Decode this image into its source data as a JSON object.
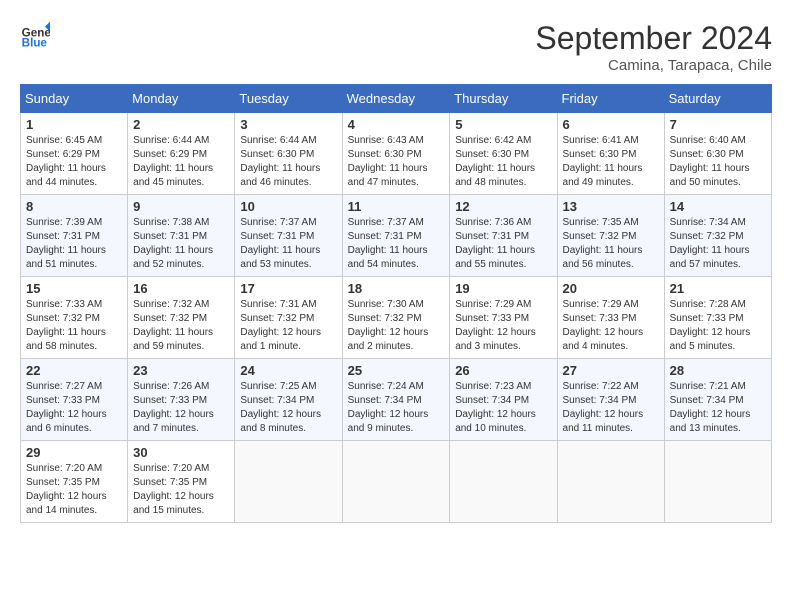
{
  "header": {
    "logo_line1": "General",
    "logo_line2": "Blue",
    "month": "September 2024",
    "location": "Camina, Tarapaca, Chile"
  },
  "weekdays": [
    "Sunday",
    "Monday",
    "Tuesday",
    "Wednesday",
    "Thursday",
    "Friday",
    "Saturday"
  ],
  "weeks": [
    [
      {
        "day": "1",
        "info": "Sunrise: 6:45 AM\nSunset: 6:29 PM\nDaylight: 11 hours\nand 44 minutes."
      },
      {
        "day": "2",
        "info": "Sunrise: 6:44 AM\nSunset: 6:29 PM\nDaylight: 11 hours\nand 45 minutes."
      },
      {
        "day": "3",
        "info": "Sunrise: 6:44 AM\nSunset: 6:30 PM\nDaylight: 11 hours\nand 46 minutes."
      },
      {
        "day": "4",
        "info": "Sunrise: 6:43 AM\nSunset: 6:30 PM\nDaylight: 11 hours\nand 47 minutes."
      },
      {
        "day": "5",
        "info": "Sunrise: 6:42 AM\nSunset: 6:30 PM\nDaylight: 11 hours\nand 48 minutes."
      },
      {
        "day": "6",
        "info": "Sunrise: 6:41 AM\nSunset: 6:30 PM\nDaylight: 11 hours\nand 49 minutes."
      },
      {
        "day": "7",
        "info": "Sunrise: 6:40 AM\nSunset: 6:30 PM\nDaylight: 11 hours\nand 50 minutes."
      }
    ],
    [
      {
        "day": "8",
        "info": "Sunrise: 7:39 AM\nSunset: 7:31 PM\nDaylight: 11 hours\nand 51 minutes."
      },
      {
        "day": "9",
        "info": "Sunrise: 7:38 AM\nSunset: 7:31 PM\nDaylight: 11 hours\nand 52 minutes."
      },
      {
        "day": "10",
        "info": "Sunrise: 7:37 AM\nSunset: 7:31 PM\nDaylight: 11 hours\nand 53 minutes."
      },
      {
        "day": "11",
        "info": "Sunrise: 7:37 AM\nSunset: 7:31 PM\nDaylight: 11 hours\nand 54 minutes."
      },
      {
        "day": "12",
        "info": "Sunrise: 7:36 AM\nSunset: 7:31 PM\nDaylight: 11 hours\nand 55 minutes."
      },
      {
        "day": "13",
        "info": "Sunrise: 7:35 AM\nSunset: 7:32 PM\nDaylight: 11 hours\nand 56 minutes."
      },
      {
        "day": "14",
        "info": "Sunrise: 7:34 AM\nSunset: 7:32 PM\nDaylight: 11 hours\nand 57 minutes."
      }
    ],
    [
      {
        "day": "15",
        "info": "Sunrise: 7:33 AM\nSunset: 7:32 PM\nDaylight: 11 hours\nand 58 minutes."
      },
      {
        "day": "16",
        "info": "Sunrise: 7:32 AM\nSunset: 7:32 PM\nDaylight: 11 hours\nand 59 minutes."
      },
      {
        "day": "17",
        "info": "Sunrise: 7:31 AM\nSunset: 7:32 PM\nDaylight: 12 hours\nand 1 minute."
      },
      {
        "day": "18",
        "info": "Sunrise: 7:30 AM\nSunset: 7:32 PM\nDaylight: 12 hours\nand 2 minutes."
      },
      {
        "day": "19",
        "info": "Sunrise: 7:29 AM\nSunset: 7:33 PM\nDaylight: 12 hours\nand 3 minutes."
      },
      {
        "day": "20",
        "info": "Sunrise: 7:29 AM\nSunset: 7:33 PM\nDaylight: 12 hours\nand 4 minutes."
      },
      {
        "day": "21",
        "info": "Sunrise: 7:28 AM\nSunset: 7:33 PM\nDaylight: 12 hours\nand 5 minutes."
      }
    ],
    [
      {
        "day": "22",
        "info": "Sunrise: 7:27 AM\nSunset: 7:33 PM\nDaylight: 12 hours\nand 6 minutes."
      },
      {
        "day": "23",
        "info": "Sunrise: 7:26 AM\nSunset: 7:33 PM\nDaylight: 12 hours\nand 7 minutes."
      },
      {
        "day": "24",
        "info": "Sunrise: 7:25 AM\nSunset: 7:34 PM\nDaylight: 12 hours\nand 8 minutes."
      },
      {
        "day": "25",
        "info": "Sunrise: 7:24 AM\nSunset: 7:34 PM\nDaylight: 12 hours\nand 9 minutes."
      },
      {
        "day": "26",
        "info": "Sunrise: 7:23 AM\nSunset: 7:34 PM\nDaylight: 12 hours\nand 10 minutes."
      },
      {
        "day": "27",
        "info": "Sunrise: 7:22 AM\nSunset: 7:34 PM\nDaylight: 12 hours\nand 11 minutes."
      },
      {
        "day": "28",
        "info": "Sunrise: 7:21 AM\nSunset: 7:34 PM\nDaylight: 12 hours\nand 13 minutes."
      }
    ],
    [
      {
        "day": "29",
        "info": "Sunrise: 7:20 AM\nSunset: 7:35 PM\nDaylight: 12 hours\nand 14 minutes."
      },
      {
        "day": "30",
        "info": "Sunrise: 7:20 AM\nSunset: 7:35 PM\nDaylight: 12 hours\nand 15 minutes."
      },
      null,
      null,
      null,
      null,
      null
    ]
  ]
}
